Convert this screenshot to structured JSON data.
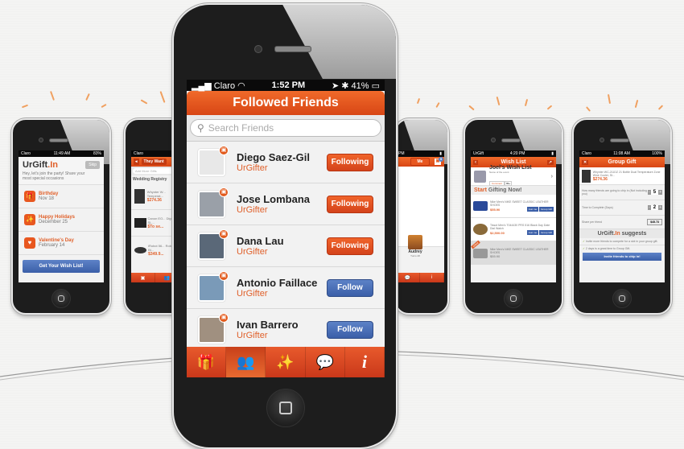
{
  "main_phone": {
    "status_bar": {
      "carrier": "Claro",
      "time": "1:52 PM",
      "battery": "41%"
    },
    "title": "Followed Friends",
    "search": {
      "placeholder": "Search Friends"
    },
    "friends": [
      {
        "name": "Diego Saez-Gil",
        "subtitle": "UrGifter",
        "action": "Following"
      },
      {
        "name": "Jose Lombana",
        "subtitle": "UrGifter",
        "action": "Following"
      },
      {
        "name": "Dana Lau",
        "subtitle": "UrGifter",
        "action": "Following"
      },
      {
        "name": "Antonio Faillace",
        "subtitle": "UrGifter",
        "action": "Follow"
      },
      {
        "name": "Ivan Barrero",
        "subtitle": "UrGifter",
        "action": "Follow"
      }
    ],
    "tabs": [
      {
        "icon": "gift-icon",
        "glyph": "🎁"
      },
      {
        "icon": "people-icon",
        "glyph": "👥"
      },
      {
        "icon": "magic-wand-icon",
        "glyph": "✨"
      },
      {
        "icon": "chat-icon",
        "glyph": "💬"
      },
      {
        "icon": "info-icon",
        "glyph": "i"
      }
    ]
  },
  "phone_welcome": {
    "status_bar": {
      "carrier": "Claro",
      "time": "11:49 AM",
      "battery": "83%"
    },
    "logo": "UrGift",
    "logo_suffix": ".In",
    "skip": "Skip",
    "intro": "Hey, let's join the party! Share your most special occasions",
    "occasions": [
      {
        "title": "Birthday",
        "date": "Nov 18"
      },
      {
        "title": "Happy Holidays",
        "date": "December 25"
      },
      {
        "title": "Valentine's Day",
        "date": "February 14"
      }
    ],
    "cta": "Get Your Wish List!"
  },
  "phone_registry": {
    "tab": "They Want",
    "search_placeholder": "Add More Gifts",
    "section": "Wedding Registry",
    "items": [
      {
        "desc": "Whynter W... Temperat...",
        "price": "$274.36"
      },
      {
        "desc": "Canon EO... Digital SL...",
        "price": "$To se..."
      },
      {
        "desc": "iRobot 56... Robot, Bl...",
        "price": "$349.9..."
      }
    ]
  },
  "phone_me": {
    "time": "PM",
    "tab": "Me",
    "notification_count": "5",
    "friend": {
      "name": "Audrey",
      "sub": "Turns 28"
    }
  },
  "phone_wishlist": {
    "status_bar": {
      "carrier": "UrGift",
      "time": "4:20 PM"
    },
    "title": "Wish List",
    "owner": "Joel's Wish List",
    "event_placeholder": "Name of the event",
    "comment": "Comment",
    "comment_count": "99+",
    "start": "Start",
    "gifting": "Gifting Now!",
    "items": [
      {
        "desc": "Nike Men's NIKE SWEET CLASSIC LEATHER SHOES",
        "price": "$55.90",
        "just_me": "Just me",
        "group": "Group Gift"
      },
      {
        "desc": "Tissot Men's T044430 PRS 516 Black Day Date Dial Watch",
        "price": "$2,500.00",
        "just_me": "Just me",
        "group": "Group Gift"
      },
      {
        "desc": "Nike Men's NIKE SWEET CLASSIC LEATHER SHOES",
        "price": "$55.90",
        "ribbon": "Gifted"
      }
    ]
  },
  "phone_group": {
    "status_bar": {
      "carrier": "Claro",
      "time": "11:08 AM",
      "battery": "100%"
    },
    "title": "Group Gift",
    "product": "Whynter WC-211DZ 21 Bottle Dual Temperature Zone Wine Cooler, St...",
    "price": "$274.36",
    "friends_label": "How many friends are going to chip in (Not including you)",
    "friends_value": "5",
    "time_label": "Time to Complete (Days)",
    "time_value": "2",
    "share_label": "Share per friend",
    "share_value": "$45.73",
    "suggests_brand": "UrGift",
    "suggests_suffix": ".In",
    "suggests": "suggests",
    "tips": [
      "Invite more friends to compete for a slot in your group gift.",
      "2 days is a great time to Group Gift."
    ],
    "cta": "Invite friends to chip in!"
  }
}
